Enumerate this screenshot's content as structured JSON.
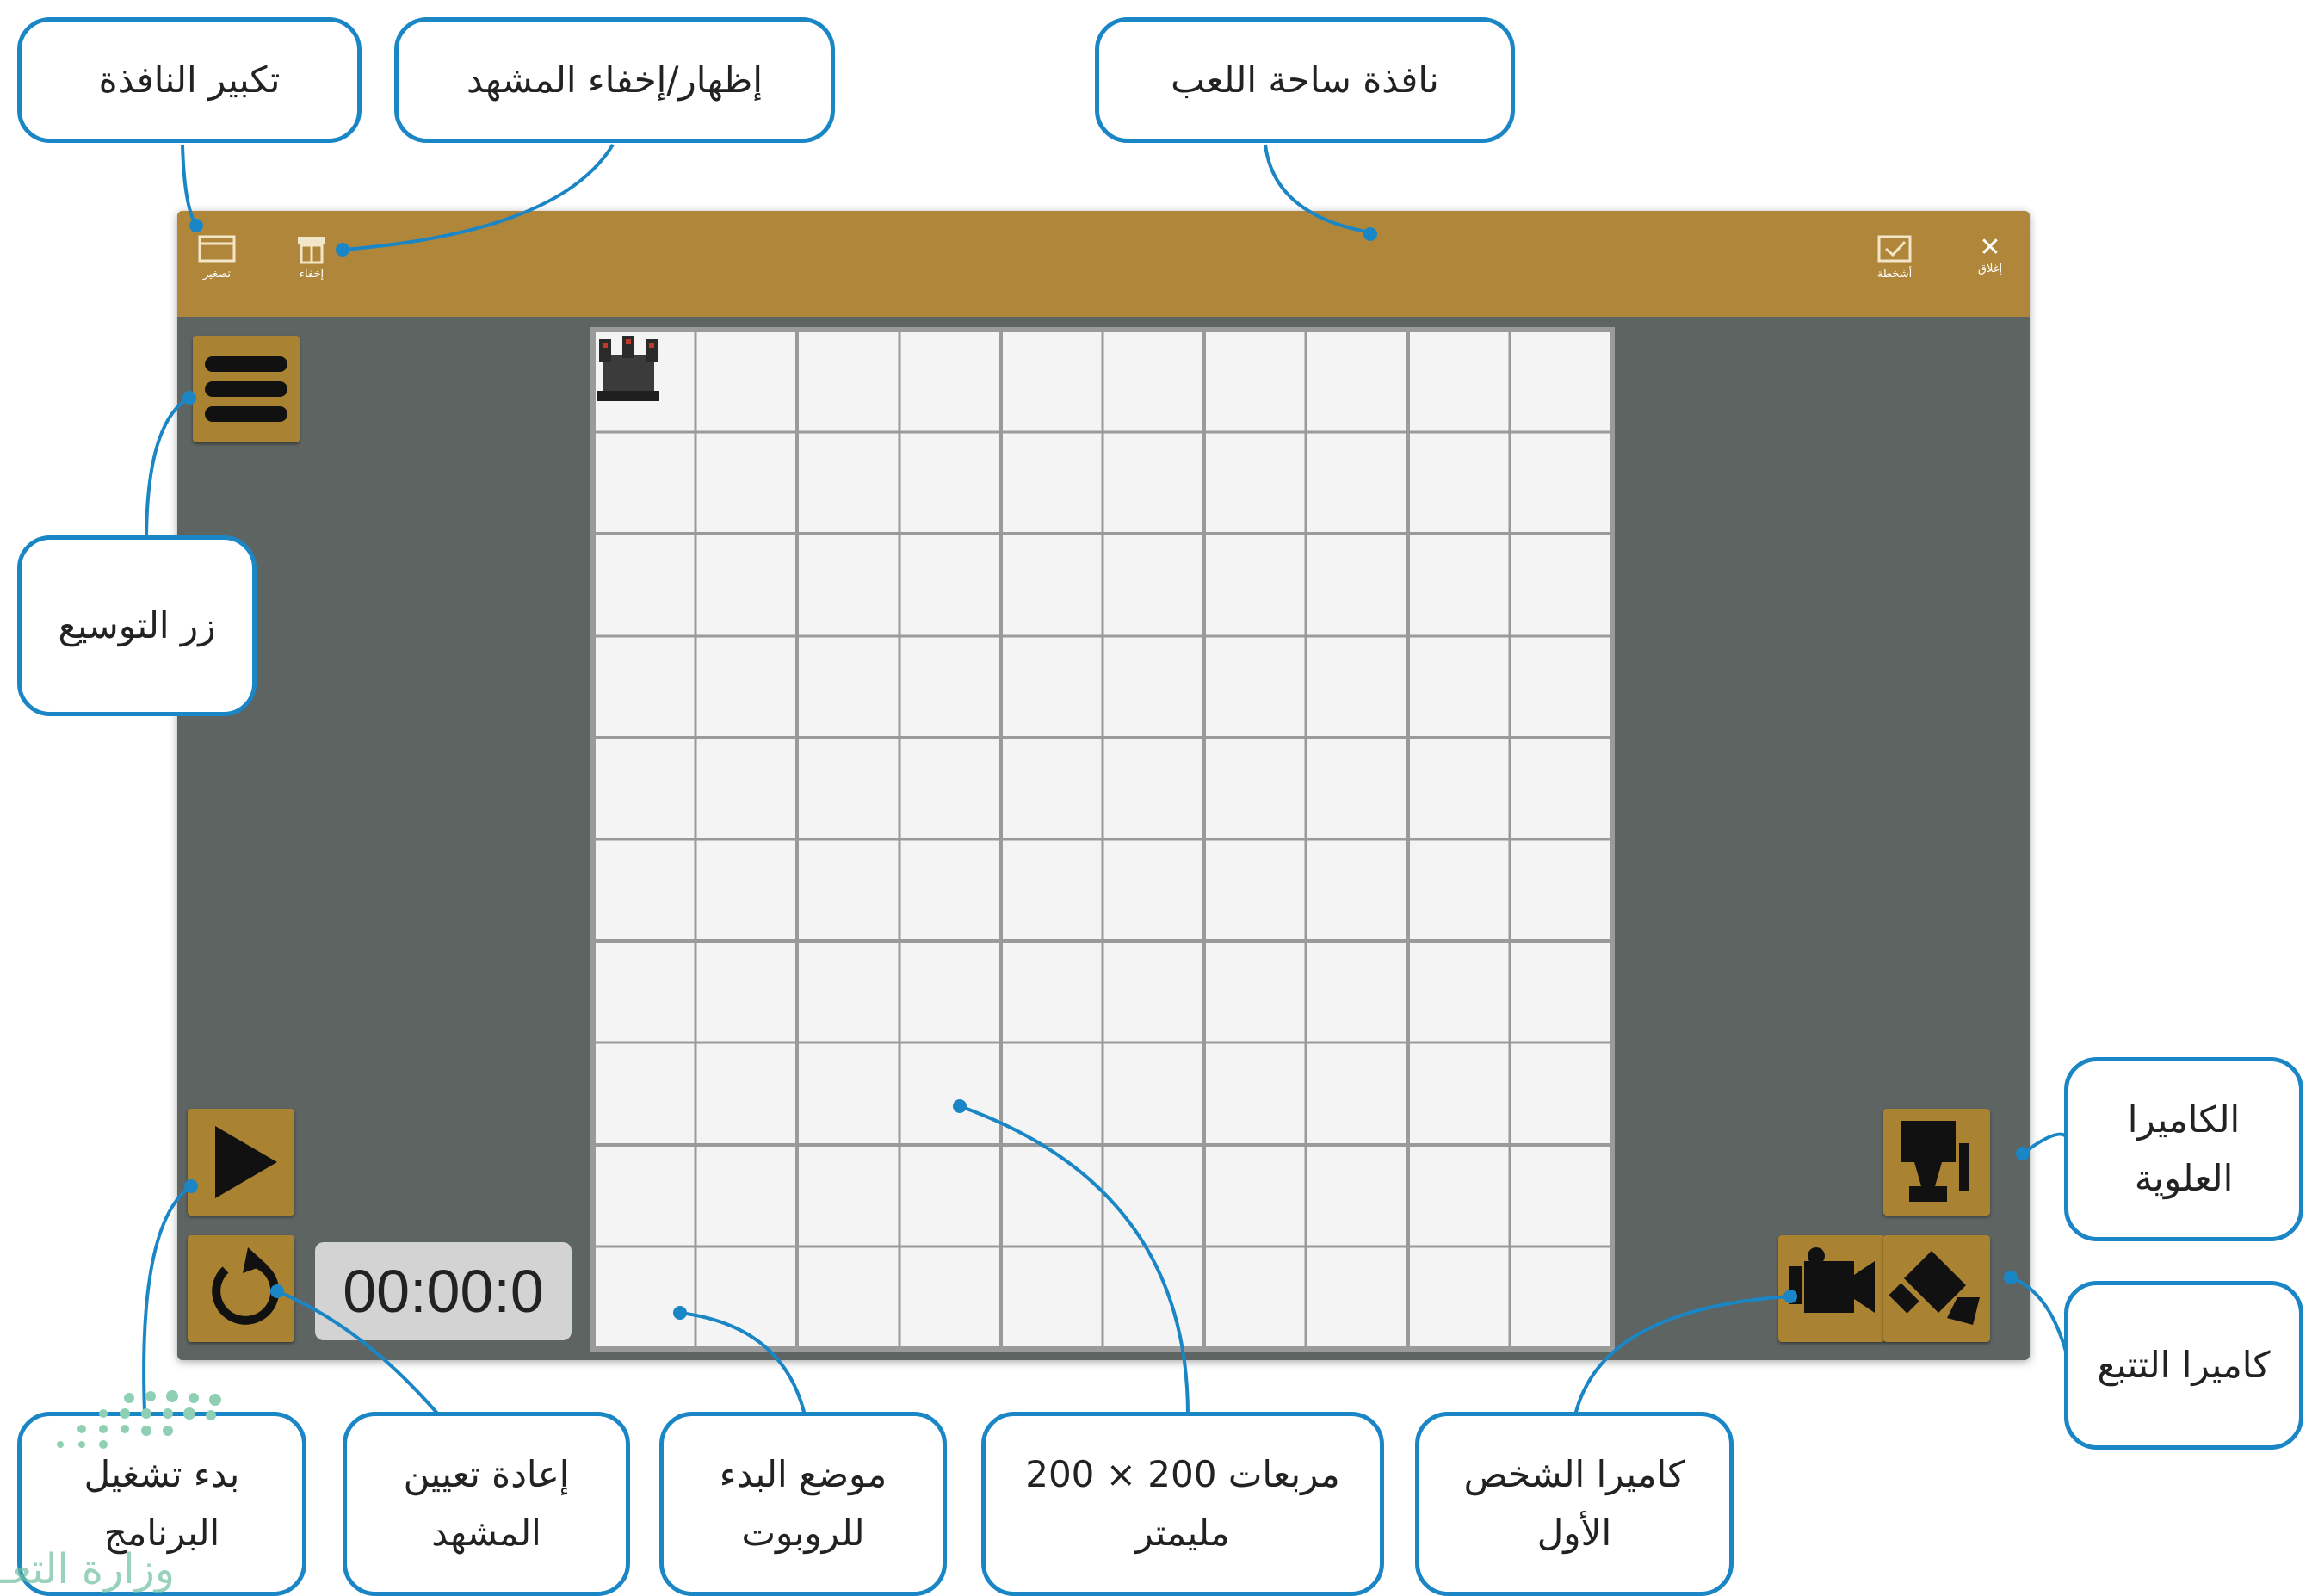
{
  "callouts": {
    "maximize": "تكبير النافذة",
    "toggle_scene": "إظهار/إخفاء المشهد",
    "playground_window": "نافذة ساحة اللعب",
    "expand_button": "زر التوسيع",
    "top_camera": "الكاميرا العلوية",
    "tracking_camera": "كاميرا التتبع",
    "start_program": "بدء تشغيل البرنامج",
    "reset_scene": "إعادة تعيين المشهد",
    "robot_start": "موضع البدء للروبوت",
    "squares": "مربعات 200 × 200 مليمتر",
    "first_person_camera": "كاميرا الشخص الأول"
  },
  "titlebar": {
    "maximize_label": "تصغير",
    "toggle_label": "إخفاء",
    "collapse_label": "أشخطة",
    "close_label": "إغلاق"
  },
  "timer": "00:00:0",
  "grid": {
    "rows": 10,
    "cols": 10
  },
  "watermark": "وزارة التعـ",
  "colors": {
    "titlebar": "#b0873a",
    "panel": "#5d6462",
    "button": "#a98232",
    "callout_border": "#1b86c6",
    "grid_line": "#9a9a9a"
  },
  "icons": {
    "maximize": "window-icon",
    "toggle": "scene-toggle-icon",
    "collapse": "checkbox-icon",
    "close": "close-icon",
    "menu": "hamburger-icon",
    "play": "play-icon",
    "reset": "reset-icon",
    "top_camera": "top-camera-icon",
    "first_person_camera": "video-camera-icon",
    "tracking_camera": "tracking-camera-icon",
    "robot": "robot-icon"
  }
}
